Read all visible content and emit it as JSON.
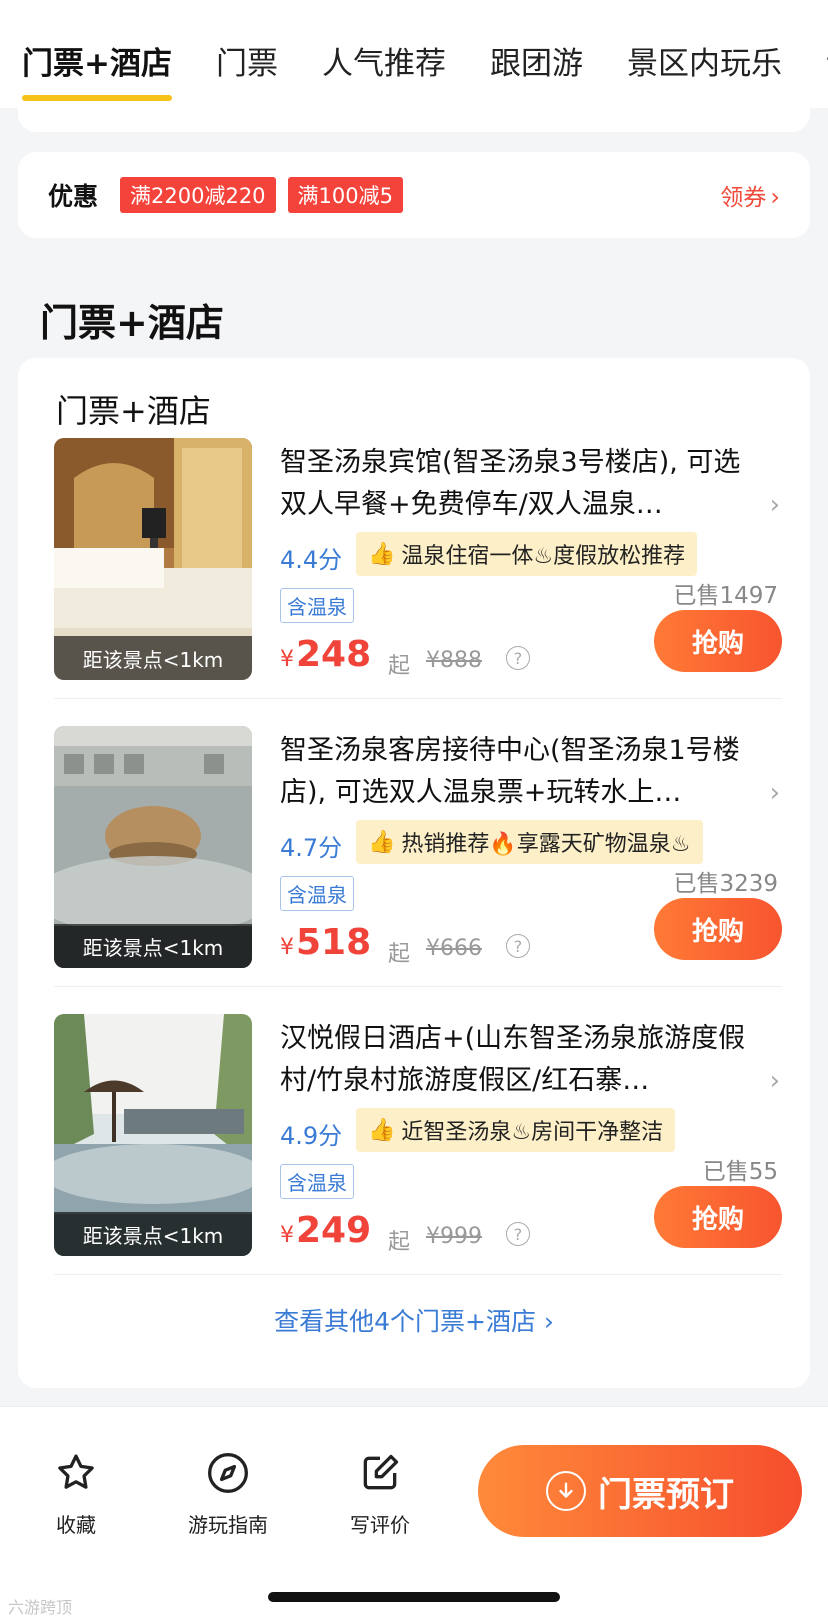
{
  "tabs": [
    "门票+酒店",
    "门票",
    "人气推荐",
    "跟团游",
    "景区内玩乐",
    "评"
  ],
  "coupon": {
    "title": "优惠",
    "tags": [
      "满2200减220",
      "满100减5"
    ],
    "get_label": "领券",
    "chevron": "›"
  },
  "section_title": "门票+酒店",
  "panel": {
    "title": "门票+酒店",
    "items": [
      {
        "name": "智圣汤泉宾馆(智圣汤泉3号楼店), 可选双人早餐+免费停车/双人温泉…",
        "distance": "距该景点<1km",
        "score": "4.4分",
        "recommend": "温泉住宿一体♨度假放松推荐",
        "tag": "含温泉",
        "sold": "已售1497",
        "currency": "¥",
        "price": "248",
        "qi": "起",
        "original": "¥888",
        "buy": "抢购"
      },
      {
        "name": "智圣汤泉客房接待中心(智圣汤泉1号楼店), 可选双人温泉票+玩转水上…",
        "distance": "距该景点<1km",
        "score": "4.7分",
        "recommend": "热销推荐🔥享露天矿物温泉♨",
        "tag": "含温泉",
        "sold": "已售3239",
        "currency": "¥",
        "price": "518",
        "qi": "起",
        "original": "¥666",
        "buy": "抢购"
      },
      {
        "name": "汉悦假日酒店+(山东智圣汤泉旅游度假村/竹泉村旅游度假区/红石寨…",
        "distance": "距该景点<1km",
        "score": "4.9分",
        "recommend": "近智圣汤泉♨房间干净整洁",
        "tag": "含温泉",
        "sold": "已售55",
        "currency": "¥",
        "price": "249",
        "qi": "起",
        "original": "¥999",
        "buy": "抢购"
      }
    ],
    "more": "查看其他4个门票+酒店 ›"
  },
  "bottom": {
    "favorite": "收藏",
    "guide": "游玩指南",
    "review": "写评价",
    "book": "门票预订"
  },
  "help_glyph": "?",
  "row_chevron": "›",
  "thumbs_glyph": "👍",
  "watermark": "六游跨顶",
  "colors": {
    "accent_yellow": "#f6c21a",
    "price_red": "#f0433a",
    "link_blue": "#3a7bd5",
    "buy_orange": "#f8552f"
  }
}
